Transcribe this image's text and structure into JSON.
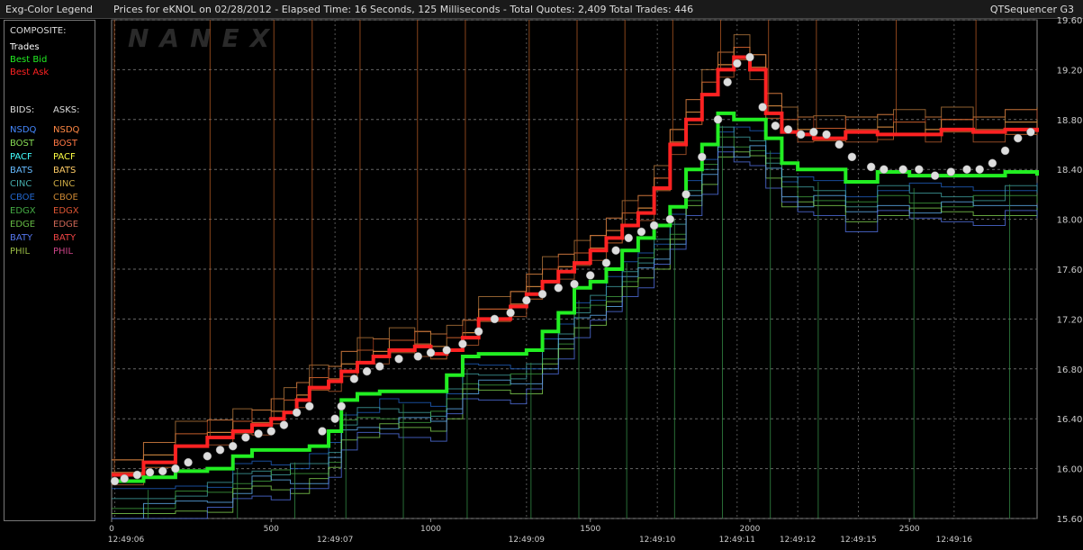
{
  "header": {
    "legend_title": "Exg-Color Legend",
    "chart_title": "Prices for  eKNOL  on  02/28/2012  -  Elapsed Time: 16 Seconds, 125 Milliseconds  -  Total Quotes: 2,409  Total Trades: 446",
    "app_name": "QTSequencer G3"
  },
  "legend": {
    "composite_label": "COMPOSITE:",
    "composite": [
      {
        "label": "Trades",
        "color": "#ffffff"
      },
      {
        "label": "Best Bid",
        "color": "#22ee22"
      },
      {
        "label": "Best Ask",
        "color": "#ff2222"
      }
    ],
    "bids_label": "BIDS:",
    "asks_label": "ASKS:",
    "exchanges": [
      {
        "bid": "NSDQ",
        "ask": "NSDQ",
        "bid_color": "#4488ff",
        "ask_color": "#ff8844"
      },
      {
        "bid": "BOST",
        "ask": "BOST",
        "bid_color": "#88dd55",
        "ask_color": "#ff7744"
      },
      {
        "bid": "PACF",
        "ask": "PACF",
        "bid_color": "#44ffff",
        "ask_color": "#ffff44"
      },
      {
        "bid": "BATS",
        "ask": "BATS",
        "bid_color": "#66bbff",
        "ask_color": "#ffcc66"
      },
      {
        "bid": "CINC",
        "ask": "CINC",
        "bid_color": "#44aaaa",
        "ask_color": "#ccaa44"
      },
      {
        "bid": "CBOE",
        "ask": "CBOE",
        "bid_color": "#2266cc",
        "ask_color": "#cc8833"
      },
      {
        "bid": "EDGX",
        "ask": "EDGX",
        "bid_color": "#44aa44",
        "ask_color": "#dd5533"
      },
      {
        "bid": "EDGE",
        "ask": "EDGE",
        "bid_color": "#66bb44",
        "ask_color": "#cc6655"
      },
      {
        "bid": "BATY",
        "ask": "BATY",
        "bid_color": "#5577ee",
        "ask_color": "#ee4444"
      },
      {
        "bid": "PHIL",
        "ask": "PHIL",
        "bid_color": "#99bb44",
        "ask_color": "#cc4488"
      }
    ]
  },
  "watermark": "NANEX",
  "chart_data": {
    "type": "line",
    "ylim": [
      15.6,
      19.6
    ],
    "y_ticks": [
      "19.60",
      "19.20",
      "18.80",
      "18.40",
      "18.00",
      "17.60",
      "17.20",
      "16.80",
      "16.40",
      "16.00",
      "15.60"
    ],
    "xlim": [
      0,
      2900
    ],
    "x_ticks": [
      "0",
      "500",
      "1000",
      "1500",
      "2000",
      "2500"
    ],
    "time_labels": [
      {
        "x": 10,
        "label": "12:49:06"
      },
      {
        "x": 700,
        "label": "12:49:07"
      },
      {
        "x": 1300,
        "label": "12:49:09"
      },
      {
        "x": 1710,
        "label": "12:49:10"
      },
      {
        "x": 1960,
        "label": "12:49:11"
      },
      {
        "x": 2150,
        "label": "12:49:12"
      },
      {
        "x": 2340,
        "label": "12:49:15"
      },
      {
        "x": 2640,
        "label": "12:49:16"
      }
    ],
    "series": [
      {
        "name": "Best Ask",
        "color": "#ff2222",
        "x": [
          0,
          100,
          200,
          300,
          380,
          440,
          500,
          540,
          580,
          620,
          680,
          720,
          770,
          820,
          870,
          950,
          1000,
          1050,
          1100,
          1150,
          1250,
          1300,
          1350,
          1400,
          1450,
          1500,
          1550,
          1600,
          1650,
          1700,
          1750,
          1800,
          1850,
          1900,
          1950,
          2000,
          2050,
          2100,
          2150,
          2200,
          2300,
          2400,
          2450,
          2550,
          2600,
          2700,
          2800,
          2900
        ],
        "values": [
          15.95,
          16.05,
          16.18,
          16.25,
          16.3,
          16.35,
          16.4,
          16.45,
          16.55,
          16.65,
          16.7,
          16.78,
          16.85,
          16.9,
          16.95,
          16.98,
          16.92,
          16.95,
          17.05,
          17.2,
          17.3,
          17.4,
          17.5,
          17.58,
          17.65,
          17.75,
          17.85,
          17.95,
          18.05,
          18.25,
          18.6,
          18.8,
          19.0,
          19.2,
          19.3,
          19.2,
          18.85,
          18.7,
          18.68,
          18.65,
          18.7,
          18.68,
          18.68,
          18.68,
          18.72,
          18.7,
          18.72,
          18.7
        ]
      },
      {
        "name": "Best Bid",
        "color": "#22ee22",
        "x": [
          0,
          100,
          200,
          300,
          380,
          440,
          500,
          560,
          620,
          680,
          720,
          770,
          840,
          900,
          1000,
          1050,
          1100,
          1150,
          1250,
          1300,
          1350,
          1400,
          1450,
          1500,
          1550,
          1600,
          1650,
          1700,
          1750,
          1800,
          1850,
          1900,
          1950,
          2000,
          2050,
          2100,
          2150,
          2200,
          2300,
          2400,
          2500,
          2600,
          2700,
          2800,
          2900
        ],
        "values": [
          15.9,
          15.93,
          15.98,
          16.0,
          16.1,
          16.15,
          16.15,
          16.15,
          16.18,
          16.3,
          16.55,
          16.6,
          16.62,
          16.62,
          16.62,
          16.75,
          16.9,
          16.92,
          16.92,
          16.95,
          17.1,
          17.25,
          17.45,
          17.5,
          17.6,
          17.75,
          17.85,
          17.95,
          18.1,
          18.4,
          18.6,
          18.85,
          18.8,
          18.8,
          18.65,
          18.45,
          18.4,
          18.4,
          18.3,
          18.38,
          18.35,
          18.35,
          18.35,
          18.38,
          18.35
        ]
      },
      {
        "name": "Trades",
        "color": "#dddddd",
        "x": [
          10,
          40,
          80,
          120,
          160,
          200,
          240,
          300,
          340,
          380,
          420,
          460,
          500,
          540,
          580,
          620,
          660,
          700,
          720,
          760,
          800,
          840,
          900,
          960,
          1000,
          1050,
          1100,
          1150,
          1200,
          1250,
          1300,
          1350,
          1400,
          1450,
          1500,
          1550,
          1580,
          1620,
          1660,
          1700,
          1750,
          1800,
          1850,
          1900,
          1930,
          1960,
          2000,
          2040,
          2080,
          2120,
          2160,
          2200,
          2240,
          2280,
          2320,
          2380,
          2420,
          2480,
          2530,
          2580,
          2630,
          2680,
          2720,
          2760,
          2800,
          2840,
          2880
        ],
        "values": [
          15.9,
          15.92,
          15.95,
          15.97,
          15.98,
          16.0,
          16.05,
          16.1,
          16.15,
          16.18,
          16.25,
          16.28,
          16.3,
          16.35,
          16.45,
          16.5,
          16.3,
          16.4,
          16.5,
          16.72,
          16.78,
          16.82,
          16.88,
          16.9,
          16.93,
          16.95,
          17.0,
          17.1,
          17.2,
          17.25,
          17.35,
          17.4,
          17.45,
          17.48,
          17.55,
          17.65,
          17.75,
          17.85,
          17.9,
          17.95,
          18.0,
          18.2,
          18.5,
          18.8,
          19.1,
          19.25,
          19.3,
          18.9,
          18.75,
          18.72,
          18.68,
          18.7,
          18.68,
          18.6,
          18.5,
          18.42,
          18.4,
          18.4,
          18.4,
          18.35,
          18.38,
          18.4,
          18.4,
          18.45,
          18.55,
          18.65,
          18.7
        ]
      }
    ]
  }
}
